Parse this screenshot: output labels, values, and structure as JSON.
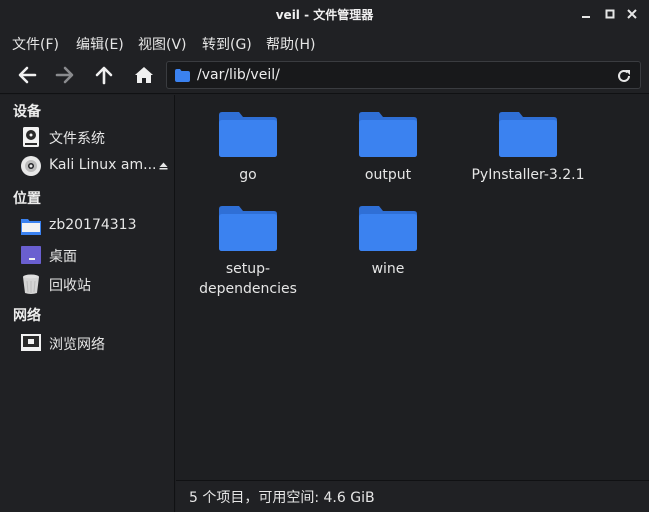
{
  "window": {
    "title": "veil - 文件管理器"
  },
  "menu": [
    {
      "label": "文件(F)"
    },
    {
      "label": "编辑(E)"
    },
    {
      "label": "视图(V)"
    },
    {
      "label": "转到(G)"
    },
    {
      "label": "帮助(H)"
    }
  ],
  "toolbar": {
    "location": "/var/lib/veil/",
    "back_icon": "arrow-left-icon",
    "forward_icon": "arrow-right-icon",
    "up_icon": "arrow-up-icon",
    "home_icon": "home-icon",
    "reload_icon": "reload-icon"
  },
  "sidebar": {
    "devices_heading": "设备",
    "places_heading": "位置",
    "network_heading": "网络",
    "devices": [
      {
        "label": "文件系统",
        "icon": "harddisk-icon"
      },
      {
        "label": "Kali Linux am...",
        "icon": "optical-disc-icon"
      }
    ],
    "places": [
      {
        "label": "zb20174313",
        "icon": "home-folder-icon"
      },
      {
        "label": "桌面",
        "icon": "desktop-icon"
      },
      {
        "label": "回收站",
        "icon": "trash-icon"
      }
    ],
    "network": [
      {
        "label": "浏览网络",
        "icon": "network-icon"
      }
    ]
  },
  "files": [
    {
      "name": "go"
    },
    {
      "name": "output"
    },
    {
      "name": "PyInstaller-3.2.1"
    },
    {
      "name": "setup-dependencies"
    },
    {
      "name": "wine"
    }
  ],
  "status": {
    "text": "5 个项目，可用空间: 4.6 GiB"
  },
  "colors": {
    "folder": "#3b82f0",
    "background": "#1e1f22",
    "panel": "#202124"
  }
}
